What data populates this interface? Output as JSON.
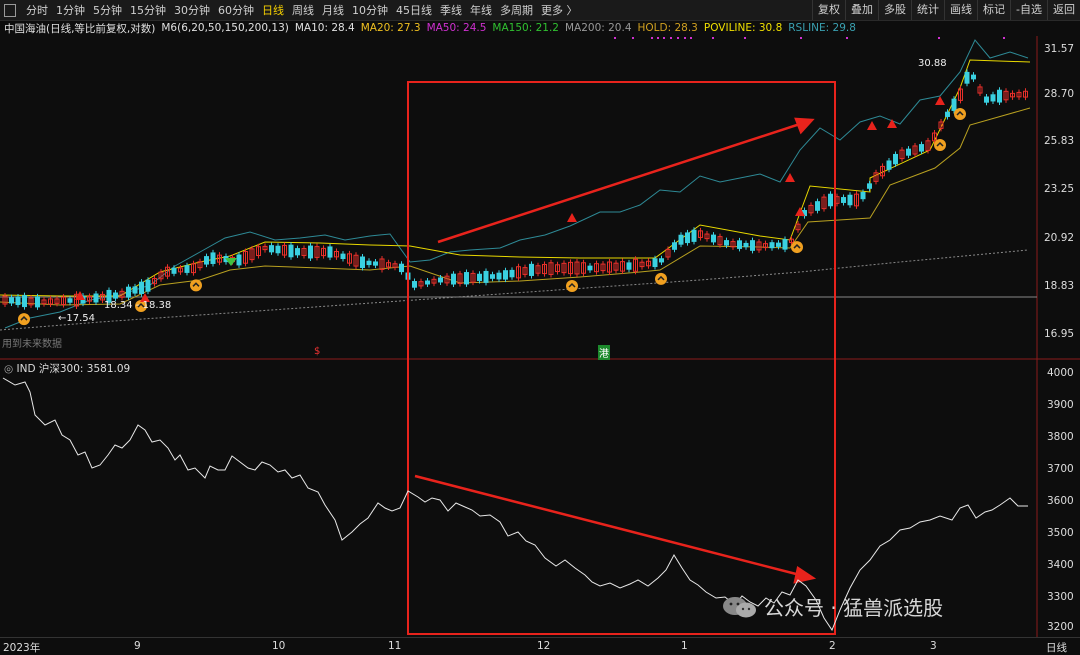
{
  "toolbar": {
    "periods": [
      "分时",
      "1分钟",
      "5分钟",
      "15分钟",
      "30分钟",
      "60分钟",
      "日线",
      "周线",
      "月线",
      "10分钟",
      "45日线",
      "季线",
      "年线",
      "多周期",
      "更多 〉"
    ],
    "active_period": "日线",
    "right_buttons": [
      "复权",
      "叠加",
      "多股",
      "统计",
      "画线",
      "标记",
      "-自选",
      "返回"
    ]
  },
  "info": {
    "title": "中国海油(日线,等比前复权,对数)",
    "indicator": "M6(6,20,50,150,200,13)",
    "ma10": "MA10: 28.4",
    "ma20": "MA20: 27.3",
    "ma50": "MA50: 24.5",
    "ma150": "MA150: 21.2",
    "ma200": "MA200: 20.4",
    "hold": "HOLD: 28.3",
    "poviline": "POVILINE: 30.8",
    "rsline": "RSLINE: 29.8",
    "colors": {
      "ma10": "#e0e0e0",
      "ma20": "#f0c020",
      "ma50": "#d030d0",
      "ma150": "#30c030",
      "ma200": "#999999",
      "hold": "#d0a020",
      "poviline": "#f0e000",
      "rsline": "#3aa0b0"
    }
  },
  "price_axis": [
    "31.57",
    "28.70",
    "25.83",
    "23.25",
    "20.92",
    "18.83",
    "16.95"
  ],
  "ind_axis": [
    "4000",
    "3900",
    "3800",
    "3700",
    "3600",
    "3500",
    "3400",
    "3300",
    "3200"
  ],
  "annotations": {
    "high_label": "30.88",
    "low_label": "←17.54",
    "range_label": "18.34 - 18.38",
    "note": "用到未来数据",
    "s_mark": "$",
    "gang_mark": "港"
  },
  "ind": {
    "label": "IND 沪深300: 3581.09"
  },
  "x_axis": {
    "labels": [
      "2023年",
      "9",
      "10",
      "11",
      "12",
      "1",
      "2",
      "3"
    ],
    "right_label": "日线"
  },
  "watermark": "公众号 · 猛兽派选股"
}
